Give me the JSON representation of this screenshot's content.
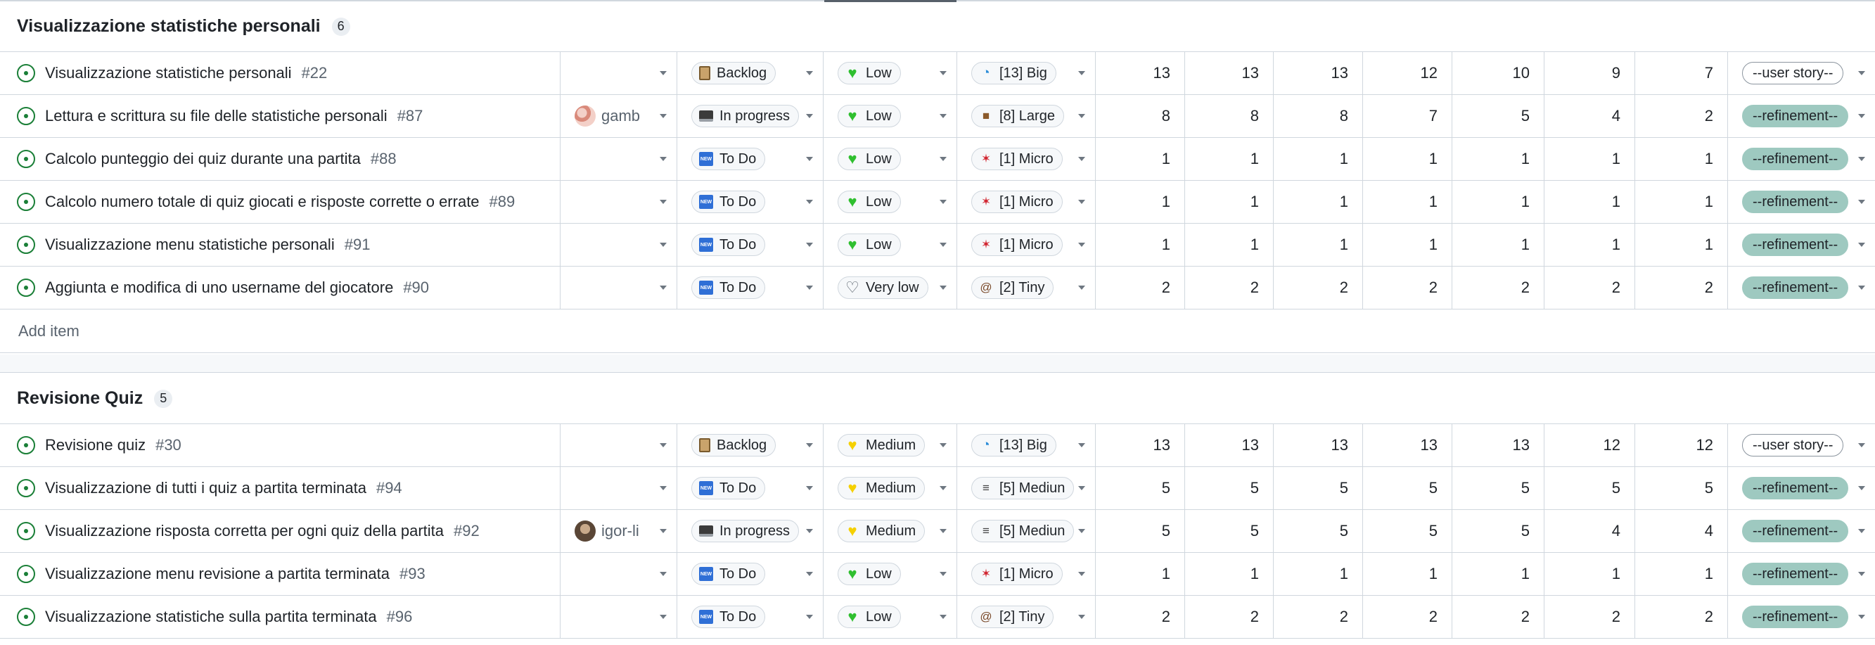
{
  "groups": [
    {
      "title": "Visualizzazione statistiche personali",
      "count": "6",
      "items": [
        {
          "title": "Visualizzazione statistiche personali",
          "number": "#22",
          "assignee": "",
          "avatar": "",
          "status": "Backlog",
          "status_icon": "clipboard",
          "priority": "Low",
          "priority_icon": "green-heart",
          "size": "[13] Big",
          "size_icon": "whale",
          "values": [
            "13",
            "13",
            "13",
            "12",
            "10",
            "9",
            "7"
          ],
          "type": "--user story--"
        },
        {
          "title": "Lettura e scrittura su file delle statistiche personali",
          "number": "#87",
          "assignee": "gamb",
          "avatar": "gamb",
          "status": "In progress",
          "status_icon": "laptop",
          "priority": "Low",
          "priority_icon": "green-heart",
          "size": "[8] Large",
          "size_icon": "bear",
          "values": [
            "8",
            "8",
            "8",
            "7",
            "5",
            "4",
            "2"
          ],
          "type": "--refinement--"
        },
        {
          "title": "Calcolo punteggio dei quiz durante una partita",
          "number": "#88",
          "assignee": "",
          "avatar": "",
          "status": "To Do",
          "status_icon": "new",
          "priority": "Low",
          "priority_icon": "green-heart",
          "size": "[1] Micro",
          "size_icon": "bug",
          "values": [
            "1",
            "1",
            "1",
            "1",
            "1",
            "1",
            "1"
          ],
          "type": "--refinement--"
        },
        {
          "title": "Calcolo numero totale di quiz giocati e risposte corrette o errate",
          "number": "#89",
          "assignee": "",
          "avatar": "",
          "status": "To Do",
          "status_icon": "new",
          "priority": "Low",
          "priority_icon": "green-heart",
          "size": "[1] Micro",
          "size_icon": "bug",
          "values": [
            "1",
            "1",
            "1",
            "1",
            "1",
            "1",
            "1"
          ],
          "type": "--refinement--"
        },
        {
          "title": "Visualizzazione menu statistiche personali",
          "number": "#91",
          "assignee": "",
          "avatar": "",
          "status": "To Do",
          "status_icon": "new",
          "priority": "Low",
          "priority_icon": "green-heart",
          "size": "[1] Micro",
          "size_icon": "bug",
          "values": [
            "1",
            "1",
            "1",
            "1",
            "1",
            "1",
            "1"
          ],
          "type": "--refinement--"
        },
        {
          "title": "Aggiunta e modifica di uno username del giocatore",
          "number": "#90",
          "assignee": "",
          "avatar": "",
          "status": "To Do",
          "status_icon": "new",
          "priority": "Very low",
          "priority_icon": "white-heart",
          "size": "[2] Tiny",
          "size_icon": "snail",
          "values": [
            "2",
            "2",
            "2",
            "2",
            "2",
            "2",
            "2"
          ],
          "type": "--refinement--"
        }
      ],
      "add_item": "Add item"
    },
    {
      "title": "Revisione Quiz",
      "count": "5",
      "items": [
        {
          "title": "Revisione quiz",
          "number": "#30",
          "assignee": "",
          "avatar": "",
          "status": "Backlog",
          "status_icon": "clipboard",
          "priority": "Medium",
          "priority_icon": "yellow-heart",
          "size": "[13] Big",
          "size_icon": "whale",
          "values": [
            "13",
            "13",
            "13",
            "13",
            "13",
            "12",
            "12"
          ],
          "type": "--user story--"
        },
        {
          "title": "Visualizzazione di tutti i quiz a partita terminata",
          "number": "#94",
          "assignee": "",
          "avatar": "",
          "status": "To Do",
          "status_icon": "new",
          "priority": "Medium",
          "priority_icon": "yellow-heart",
          "size": "[5] Mediun",
          "size_icon": "swan",
          "values": [
            "5",
            "5",
            "5",
            "5",
            "5",
            "5",
            "5"
          ],
          "type": "--refinement--"
        },
        {
          "title": "Visualizzazione risposta corretta per ogni quiz della partita",
          "number": "#92",
          "assignee": "igor-li",
          "avatar": "igor",
          "status": "In progress",
          "status_icon": "laptop",
          "priority": "Medium",
          "priority_icon": "yellow-heart",
          "size": "[5] Mediun",
          "size_icon": "swan",
          "values": [
            "5",
            "5",
            "5",
            "5",
            "5",
            "4",
            "4"
          ],
          "type": "--refinement--"
        },
        {
          "title": "Visualizzazione menu revisione a partita terminata",
          "number": "#93",
          "assignee": "",
          "avatar": "",
          "status": "To Do",
          "status_icon": "new",
          "priority": "Low",
          "priority_icon": "green-heart",
          "size": "[1] Micro",
          "size_icon": "bug",
          "values": [
            "1",
            "1",
            "1",
            "1",
            "1",
            "1",
            "1"
          ],
          "type": "--refinement--"
        },
        {
          "title": "Visualizzazione statistiche sulla partita terminata",
          "number": "#96",
          "assignee": "",
          "avatar": "",
          "status": "To Do",
          "status_icon": "new",
          "priority": "Low",
          "priority_icon": "green-heart",
          "size": "[2] Tiny",
          "size_icon": "snail",
          "values": [
            "2",
            "2",
            "2",
            "2",
            "2",
            "2",
            "2"
          ],
          "type": "--refinement--"
        }
      ]
    }
  ],
  "colors": {
    "open_issue": "#1a7f37",
    "refinement_label": "#9ec9c0",
    "border": "#d0d7de",
    "muted_text": "#59636e"
  }
}
